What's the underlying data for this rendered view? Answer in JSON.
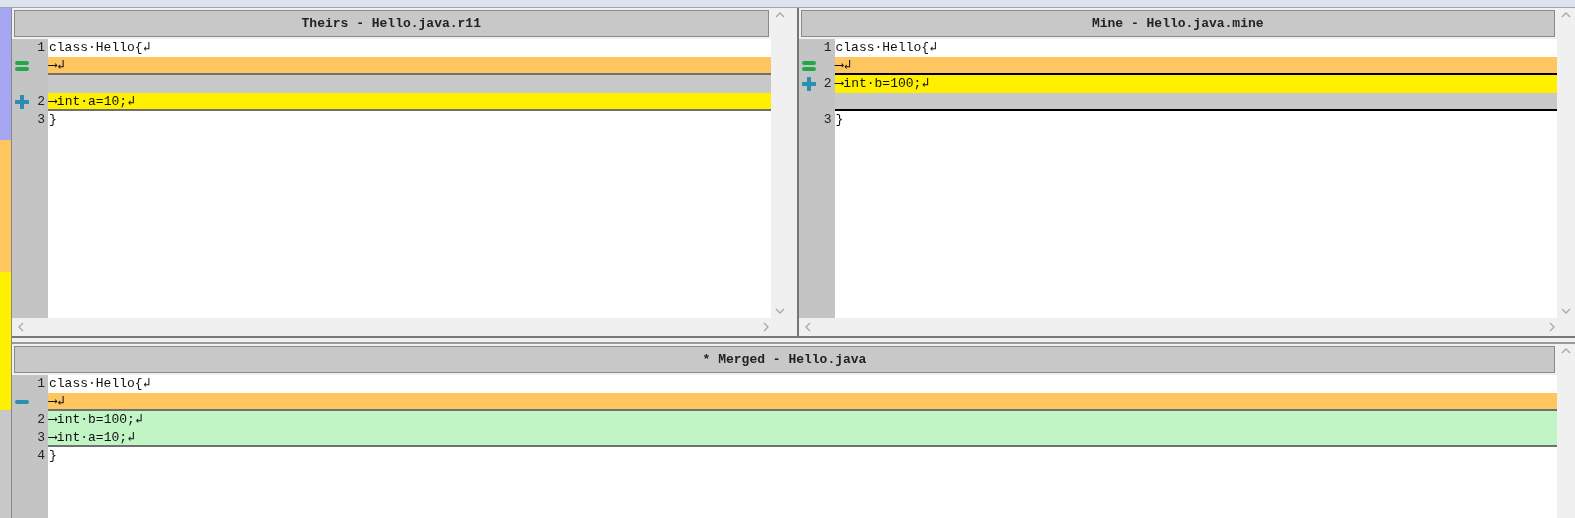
{
  "top_panes": [
    {
      "title": "Theirs - Hello.java.r11",
      "focused": false,
      "lines": [
        {
          "number": "1",
          "text": "class·Hello{↲",
          "kind": "normal",
          "separator": false
        },
        {
          "text": "⟶↲",
          "kind": "same",
          "separator": true
        },
        {
          "kind": "blank",
          "separator": false
        },
        {
          "number": "2",
          "text": "⟶int·a=10;↲",
          "kind": "added",
          "separator": true
        },
        {
          "number": "3",
          "text": "}",
          "kind": "normal",
          "separator": false
        }
      ]
    },
    {
      "title": "Mine - Hello.java.mine",
      "focused": true,
      "lines": [
        {
          "number": "1",
          "text": "class·Hello{↲",
          "kind": "normal",
          "separator": false
        },
        {
          "text": "⟶↲",
          "kind": "same",
          "separator": true
        },
        {
          "number": "2",
          "text": "⟶int·b=100;↲",
          "kind": "added",
          "separator": false
        },
        {
          "kind": "blank",
          "separator": true
        },
        {
          "number": "3",
          "text": "}",
          "kind": "normal",
          "separator": false
        }
      ]
    }
  ],
  "merged_pane": {
    "title": "* Merged - Hello.java",
    "focused": false,
    "lines": [
      {
        "number": "1",
        "text": "class·Hello{↲",
        "kind": "normal",
        "separator": false
      },
      {
        "text": "⟶↲",
        "kind": "removed",
        "separator": true
      },
      {
        "number": "2",
        "text": "⟶int·b=100;↲",
        "kind": "merged",
        "separator": false
      },
      {
        "number": "3",
        "text": "⟶int·a=10;↲",
        "kind": "merged",
        "separator": true
      },
      {
        "number": "4",
        "text": "}",
        "kind": "normal",
        "separator": false
      }
    ]
  }
}
